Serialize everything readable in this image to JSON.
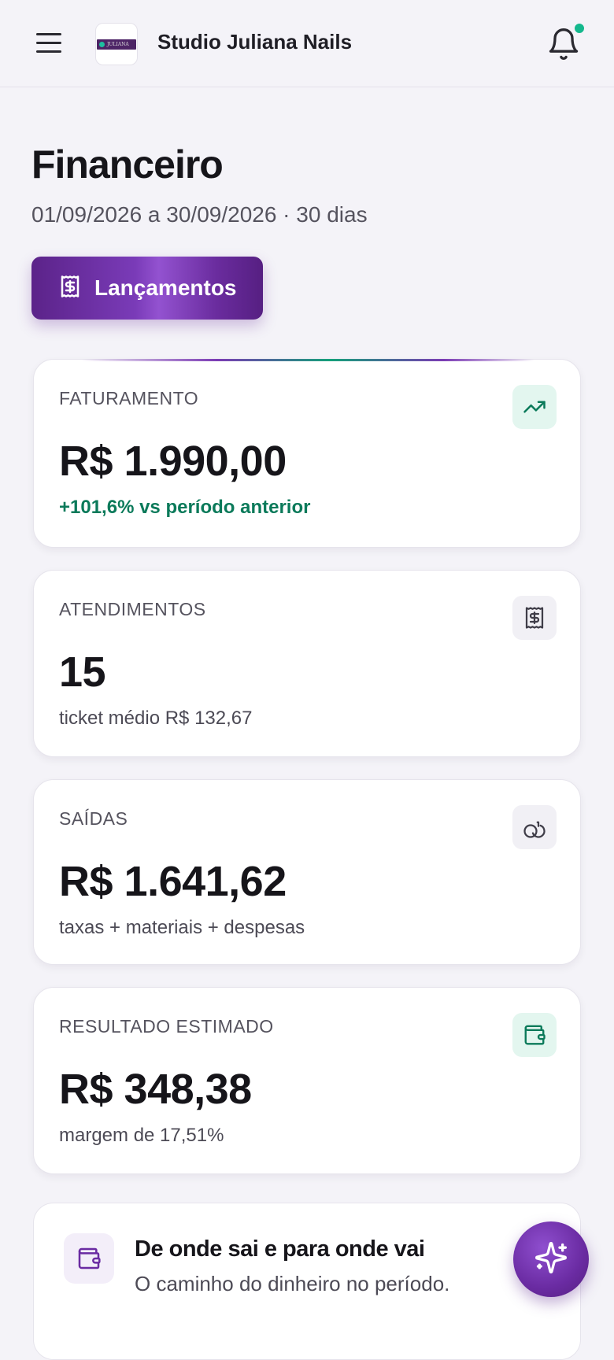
{
  "header": {
    "studio_name": "Studio Juliana Nails",
    "logo_text": "JULIANA",
    "menu_icon": "hamburger-menu-icon",
    "notification_icon": "bell-icon",
    "notification_dot_color": "#14b88d"
  },
  "page": {
    "title": "Financeiro",
    "period": "01/09/2026 a 30/09/2026 · 30 dias"
  },
  "actions": {
    "lancamentos_label": "Lançamentos",
    "lancamentos_icon": "receipt-dollar-icon"
  },
  "cards": {
    "faturamento": {
      "label": "FATURAMENTO",
      "value": "R$ 1.990,00",
      "note": "+101,6% vs período anterior",
      "icon": "trending-up-icon"
    },
    "atendimentos": {
      "label": "ATENDIMENTOS",
      "value": "15",
      "note": "ticket médio R$ 132,67",
      "icon": "receipt-dollar-icon"
    },
    "saidas": {
      "label": "SAÍDAS",
      "value": "R$ 1.641,62",
      "note": "taxas + materiais + despesas",
      "icon": "coins-icon"
    },
    "resultado": {
      "label": "RESULTADO ESTIMADO",
      "value": "R$ 348,38",
      "note": "margem de 17,51%",
      "icon": "wallet-icon"
    }
  },
  "flow": {
    "title": "De onde sai e para onde vai",
    "subtitle": "O caminho do dinheiro no período.",
    "icon": "wallet-icon"
  },
  "fab": {
    "icon": "sparkles-icon"
  },
  "colors": {
    "brand_purple": "#6a2ba2",
    "positive_green": "#0b7a5a",
    "background": "#f4f3f8"
  }
}
